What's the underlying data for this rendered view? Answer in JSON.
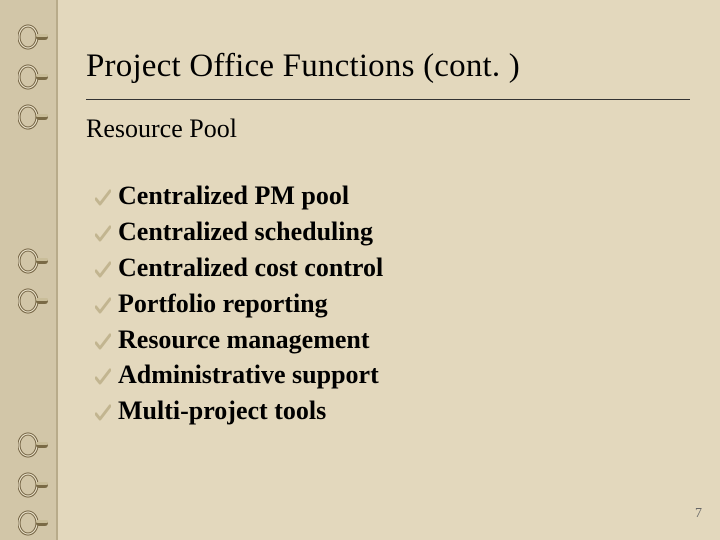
{
  "slide": {
    "title": "Project Office Functions (cont. )",
    "subtitle": "Resource Pool",
    "bullets": [
      "Centralized PM pool",
      "Centralized scheduling",
      "Centralized cost control",
      "Portfolio reporting",
      "Resource management",
      "Administrative support",
      "Multi-project tools"
    ],
    "page_number": "7"
  }
}
